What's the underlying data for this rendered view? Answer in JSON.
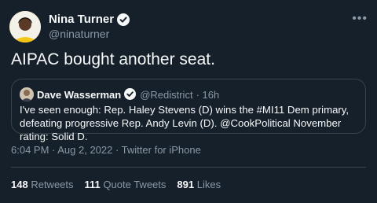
{
  "author": {
    "name": "Nina Turner",
    "handle": "@ninaturner"
  },
  "tweet": {
    "text": "AIPAC bought another seat."
  },
  "quoted": {
    "name": "Dave Wasserman",
    "handle": "@Redistrict",
    "age": "· 16h",
    "text": "I've seen enough: Rep. Haley Stevens (D) wins the #MI11 Dem primary, defeating progressive Rep. Andy Levin (D). @CookPolitical November rating: Solid D."
  },
  "meta": {
    "timestamp": "6:04 PM · Aug 2, 2022 · Twitter for iPhone"
  },
  "stats": [
    {
      "count": "148",
      "label": "Retweets"
    },
    {
      "count": "111",
      "label": "Quote Tweets"
    },
    {
      "count": "891",
      "label": "Likes"
    }
  ],
  "icons": {
    "more": "more-options-icon",
    "verified": "verified-badge-icon"
  },
  "colors": {
    "background": "#15202b",
    "verified": "#1d9bf0",
    "secondary_text": "#8b98a5",
    "border": "#38444d"
  }
}
